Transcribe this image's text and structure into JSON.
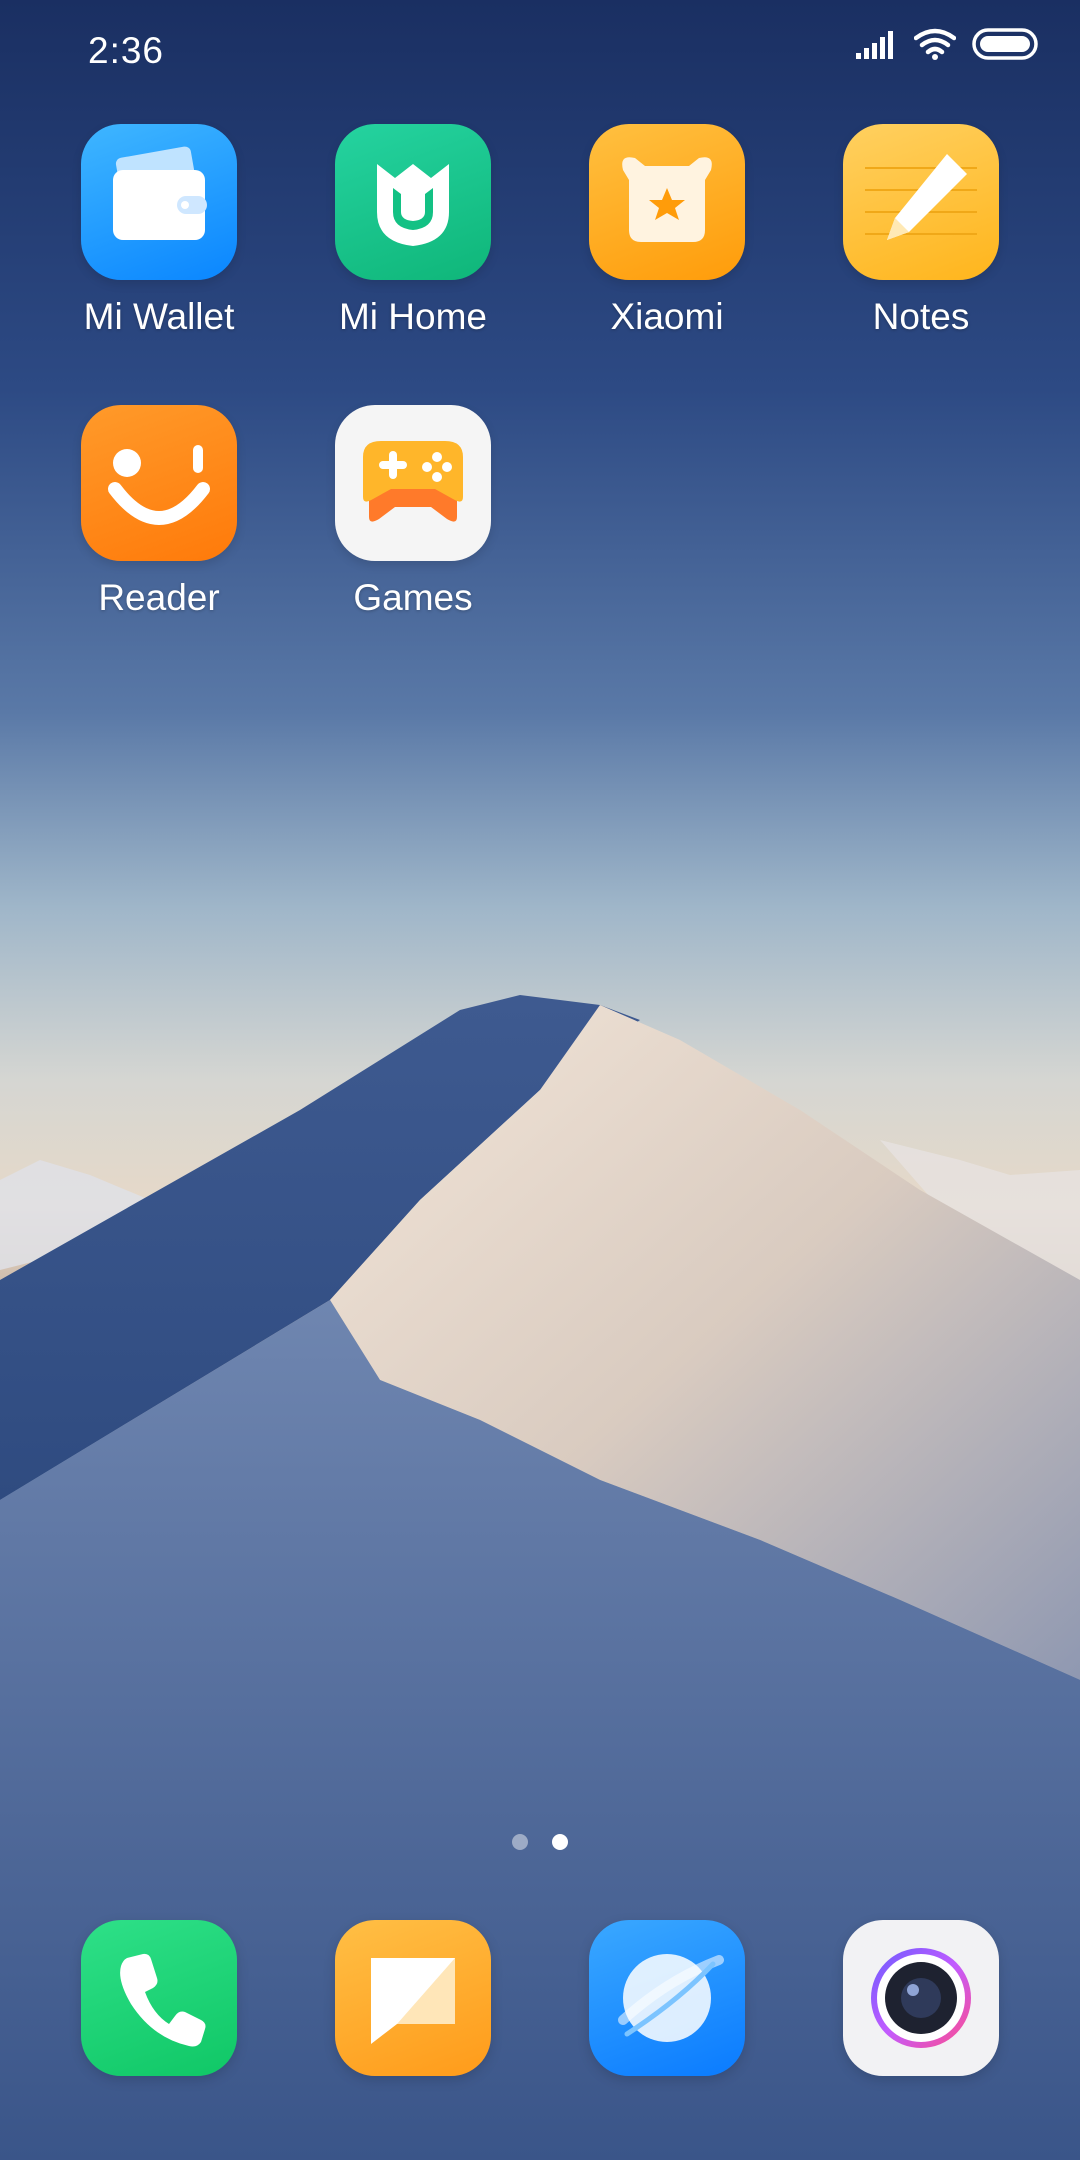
{
  "status_bar": {
    "time": "2:36"
  },
  "home_grid": {
    "apps": [
      {
        "label": "Mi Wallet",
        "icon": "wallet-icon",
        "color": "#1ea1ff"
      },
      {
        "label": "Mi Home",
        "icon": "mi-home-icon",
        "color": "#19c48b"
      },
      {
        "label": "Xiaomi",
        "icon": "xiaomi-bunny-icon",
        "color": "#ffab1a"
      },
      {
        "label": "Notes",
        "icon": "notes-pencil-icon",
        "color": "#ffc23a"
      },
      {
        "label": "Reader",
        "icon": "reader-smile-icon",
        "color": "#ff8a1a"
      },
      {
        "label": "Games",
        "icon": "gamepad-icon",
        "color": "#ffffff"
      }
    ]
  },
  "pager": {
    "total": 2,
    "active_index": 1
  },
  "dock": {
    "apps": [
      {
        "name": "phone",
        "icon": "phone-icon",
        "color": "#19d36f"
      },
      {
        "name": "messages",
        "icon": "message-icon",
        "color": "#ffa52a"
      },
      {
        "name": "browser",
        "icon": "browser-planet-icon",
        "color": "#1e90ff"
      },
      {
        "name": "camera",
        "icon": "camera-icon",
        "color": "#f2f2f4"
      }
    ]
  }
}
